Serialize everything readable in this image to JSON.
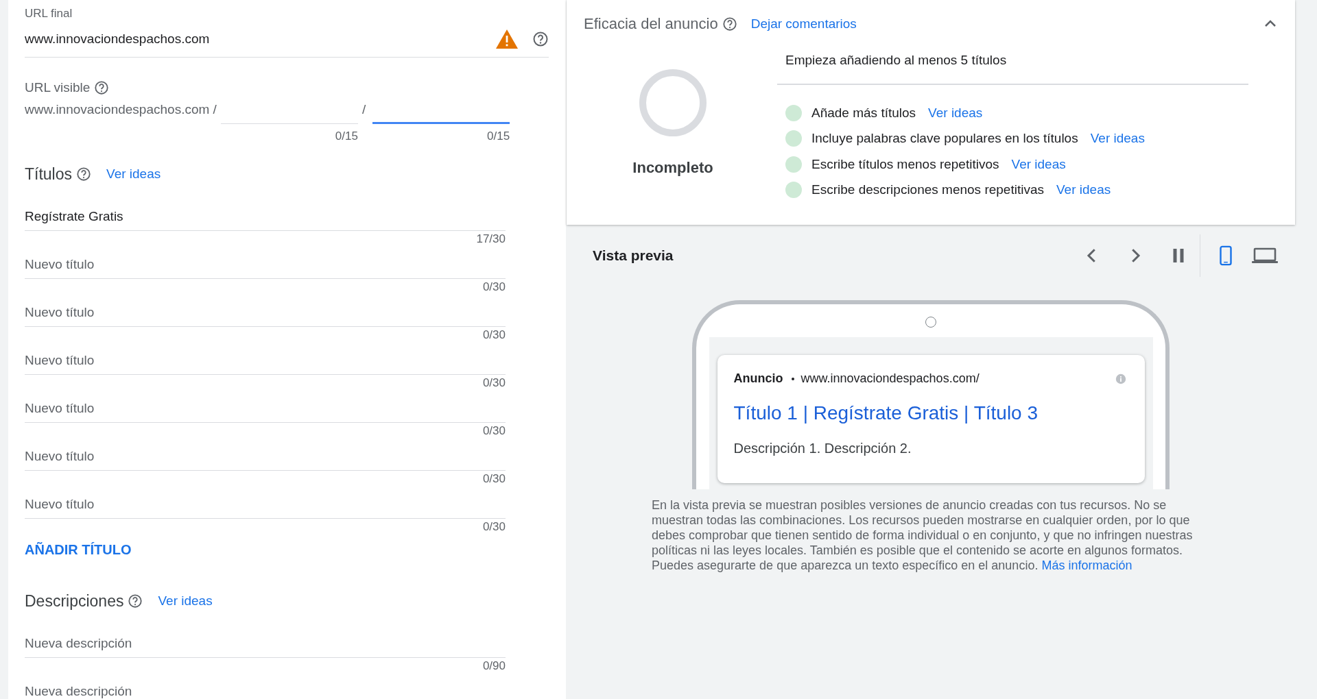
{
  "final_url": {
    "label": "URL final",
    "value": "www.innovaciondespachos.com",
    "warning": true
  },
  "display_url": {
    "label": "URL visible",
    "domain": "www.innovaciondespachos.com /",
    "separator": "/",
    "paths": [
      {
        "counter": "0/15",
        "focused": false
      },
      {
        "counter": "0/15",
        "focused": true
      }
    ]
  },
  "headlines": {
    "heading": "Títulos",
    "link": "Ver ideas",
    "fields": [
      {
        "value": "Regístrate Gratis",
        "counter": "17/30"
      },
      {
        "placeholder": "Nuevo título",
        "counter": "0/30"
      },
      {
        "placeholder": "Nuevo título",
        "counter": "0/30"
      },
      {
        "placeholder": "Nuevo título",
        "counter": "0/30"
      },
      {
        "placeholder": "Nuevo título",
        "counter": "0/30"
      },
      {
        "placeholder": "Nuevo título",
        "counter": "0/30"
      },
      {
        "placeholder": "Nuevo título",
        "counter": "0/30"
      }
    ],
    "add_button": "AÑADIR TÍTULO"
  },
  "descriptions": {
    "heading": "Descripciones",
    "link": "Ver ideas",
    "fields": [
      {
        "placeholder": "Nueva descripción",
        "counter": "0/90"
      },
      {
        "placeholder": "Nueva descripción"
      }
    ]
  },
  "ad_strength": {
    "title": "Eficacia del anuncio",
    "feedback_link": "Dejar comentarios",
    "expanded": true,
    "rating": "Incompleto",
    "hint": "Empieza añadiendo al menos 5 títulos",
    "tips": [
      {
        "text": "Añade más títulos",
        "link": "Ver ideas"
      },
      {
        "text": "Incluye palabras clave populares en los títulos",
        "link": "Ver ideas"
      },
      {
        "text": "Escribe títulos menos repetitivos",
        "link": "Ver ideas"
      },
      {
        "text": "Escribe descripciones menos repetitivas",
        "link": "Ver ideas"
      }
    ]
  },
  "preview": {
    "title": "Vista previa",
    "devices": [
      {
        "kind": "mobile",
        "selected": true
      },
      {
        "kind": "desktop",
        "selected": false
      }
    ],
    "ad": {
      "label": "Anuncio",
      "url": "www.innovaciondespachos.com/",
      "headline": "Título 1 | Regístrate Gratis | Título 3",
      "description": "Descripción 1. Descripción 2."
    },
    "disclaimer": "En la vista previa se muestran posibles versiones de anuncio creadas con tus recursos. No se muestran todas las combinaciones. Los recursos pueden mostrarse en cualquier orden, por lo que debes comprobar que tienen sentido de forma individual o en conjunto, y que no infringen nuestras políticas ni las leyes locales. También es posible que el contenido se acorte en algunos formatos. Puedes asegurarte de que aparezca un texto específico en el anuncio.",
    "disclaimer_link": "Más información"
  }
}
